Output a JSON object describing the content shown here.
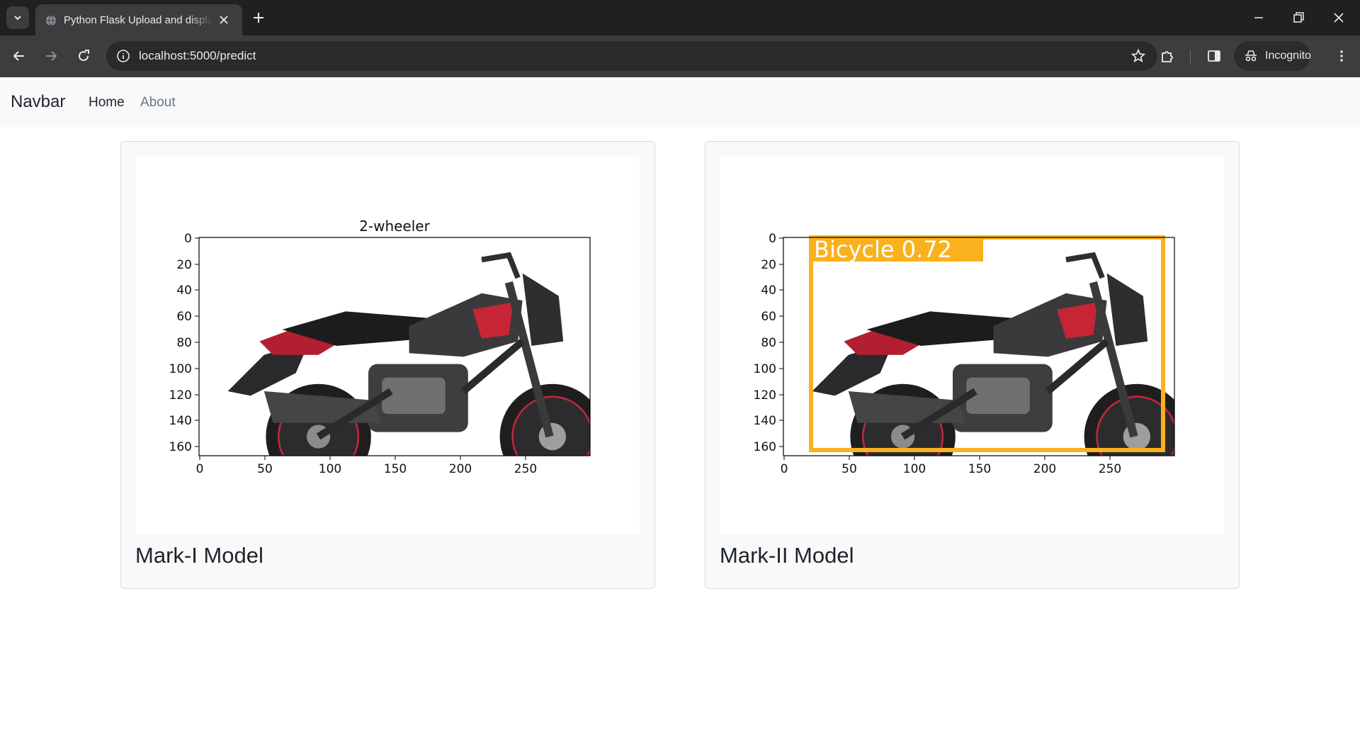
{
  "browser": {
    "tab_title": "Python Flask Upload and display image",
    "url": "localhost:5000/predict",
    "incognito_label": "Incognito"
  },
  "navbar": {
    "brand": "Navbar",
    "links": [
      {
        "label": "Home"
      },
      {
        "label": "About"
      }
    ]
  },
  "cards": [
    {
      "title": "Mark-I Model",
      "plot": {
        "title": "2-wheeler",
        "x_ticks": [
          "0",
          "50",
          "100",
          "150",
          "200",
          "250"
        ],
        "y_ticks": [
          "0",
          "20",
          "40",
          "60",
          "80",
          "100",
          "120",
          "140",
          "160"
        ],
        "image": "motorcycle-photo"
      }
    },
    {
      "title": "Mark-II Model",
      "plot": {
        "title": "",
        "x_ticks": [
          "0",
          "50",
          "100",
          "150",
          "200",
          "250"
        ],
        "y_ticks": [
          "0",
          "20",
          "40",
          "60",
          "80",
          "100",
          "120",
          "140",
          "160"
        ],
        "image": "motorcycle-photo",
        "detection": {
          "label": "Bicycle 0.72",
          "color": "#f9b11e"
        }
      }
    }
  ],
  "colors": {
    "chrome_dark": "#1f2021",
    "chrome_toolbar": "#3c3d3f",
    "navbar_bg": "#f8f9fa",
    "bike_accent": "#d42a3a"
  }
}
